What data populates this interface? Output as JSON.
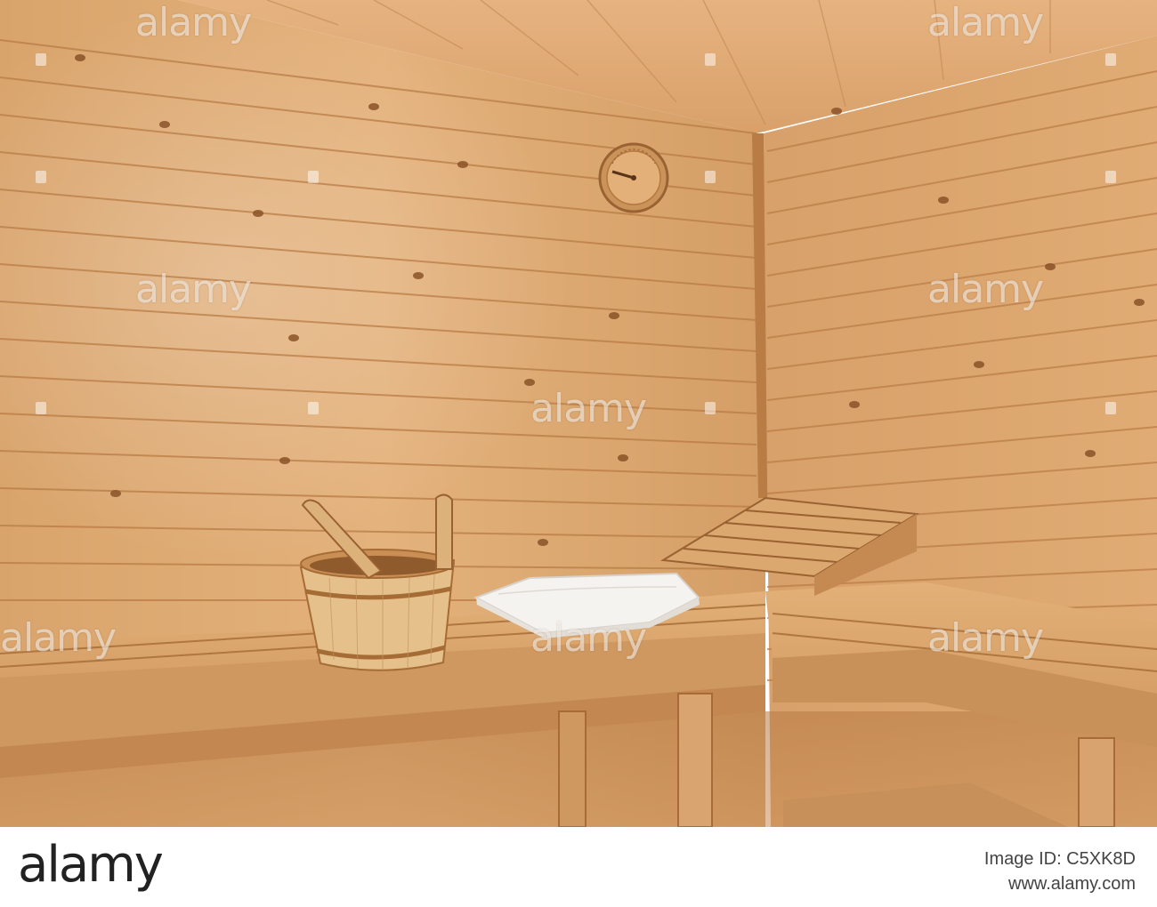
{
  "watermark": {
    "text": "alamy"
  },
  "footer": {
    "logo": "alamy",
    "image_id_label": "Image ID: C5XK8D",
    "site": "www.alamy.com"
  },
  "colors": {
    "wood_light": "#e2b07a",
    "wood_mid": "#d19a62",
    "wood_dark": "#a86a38",
    "trim": "#b97c45",
    "towel": "#f4f2ee"
  },
  "objects": {
    "thermometer": "sauna-thermometer-icon",
    "bucket": "sauna-bucket-icon",
    "ladle": "sauna-ladle-icon",
    "towel": "folded-towel-icon",
    "headrest": "headrest-icon"
  }
}
